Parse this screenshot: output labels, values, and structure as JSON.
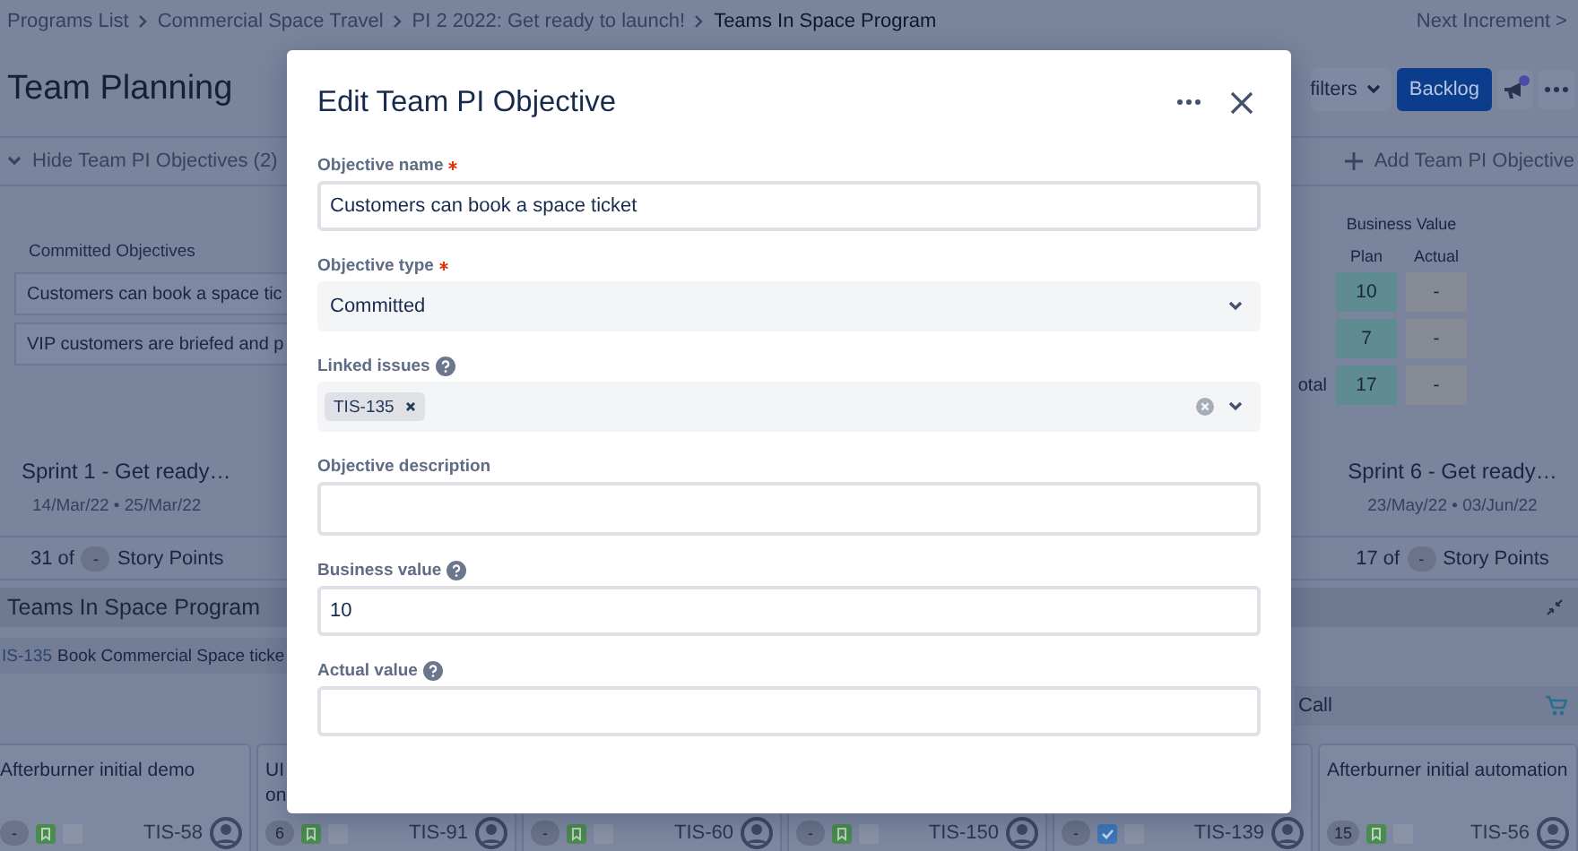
{
  "breadcrumbs": [
    {
      "label": "Programs List",
      "current": false
    },
    {
      "label": "Commercial Space Travel",
      "current": false
    },
    {
      "label": "PI 2 2022: Get ready to launch!",
      "current": false
    },
    {
      "label": "Teams In Space Program",
      "current": true
    }
  ],
  "next_increment": "Next Increment >",
  "page_title": "Team Planning",
  "toolbar": {
    "filters": "filters",
    "backlog": "Backlog"
  },
  "objectives_bar": {
    "toggle": "Hide Team PI Objectives (2)",
    "add": "Add Team PI Objective"
  },
  "committed": {
    "heading": "Committed Objectives",
    "items": [
      "Customers can book a space tic",
      "VIP customers are briefed and p"
    ]
  },
  "business_value": {
    "heading": "Business Value",
    "columns": [
      "Plan",
      "Actual"
    ],
    "rows": [
      {
        "plan": "10",
        "actual": "-"
      },
      {
        "plan": "7",
        "actual": "-"
      },
      {
        "label": "otal",
        "plan": "17",
        "actual": "-"
      }
    ]
  },
  "sprints": [
    {
      "name": "Sprint 1 - Get ready…",
      "dates": "14/Mar/22 • 25/Mar/22",
      "points": "31 of",
      "capacity": "-",
      "unit": "Story Points"
    },
    {
      "name": "Sprint 6 - Get ready…",
      "dates": "23/May/22 • 03/Jun/22",
      "points": "17 of",
      "capacity": "-",
      "unit": "Story Points"
    }
  ],
  "team": {
    "name": "Teams In Space Program"
  },
  "feature": {
    "key": "IS-135",
    "title": "Book Commercial Space ticke"
  },
  "feature_right": {
    "title": "Call"
  },
  "cards": [
    {
      "title_lines": [
        "Afterburner initial demo"
      ],
      "points": "-",
      "kind": "story",
      "key": "TIS-58"
    },
    {
      "title_lines": [
        "UI",
        "on"
      ],
      "points": "6",
      "kind": "story",
      "key": "TIS-91"
    },
    {
      "points": "-",
      "kind": "story",
      "key": "TIS-60"
    },
    {
      "points": "-",
      "kind": "story",
      "key": "TIS-150"
    },
    {
      "points": "-",
      "kind": "task",
      "key": "TIS-139"
    },
    {
      "title_lines": [
        "Afterburner initial automation"
      ],
      "points": "15",
      "kind": "story",
      "key": "TIS-56"
    }
  ],
  "modal": {
    "title": "Edit Team PI Objective",
    "fields": [
      {
        "kind": "text",
        "label": "Objective name",
        "required": true,
        "help": false,
        "value": "Customers can book a space ticket"
      },
      {
        "kind": "select",
        "label": "Objective type",
        "required": true,
        "help": false,
        "value": "Committed"
      },
      {
        "kind": "tags",
        "label": "Linked issues",
        "required": false,
        "help": true,
        "tags": [
          "TIS-135"
        ]
      },
      {
        "kind": "textarea",
        "label": "Objective description",
        "required": false,
        "help": false
      },
      {
        "kind": "text",
        "label": "Business value",
        "required": false,
        "help": true,
        "value": "10"
      },
      {
        "kind": "text",
        "label": "Actual value",
        "required": false,
        "help": true
      }
    ]
  }
}
